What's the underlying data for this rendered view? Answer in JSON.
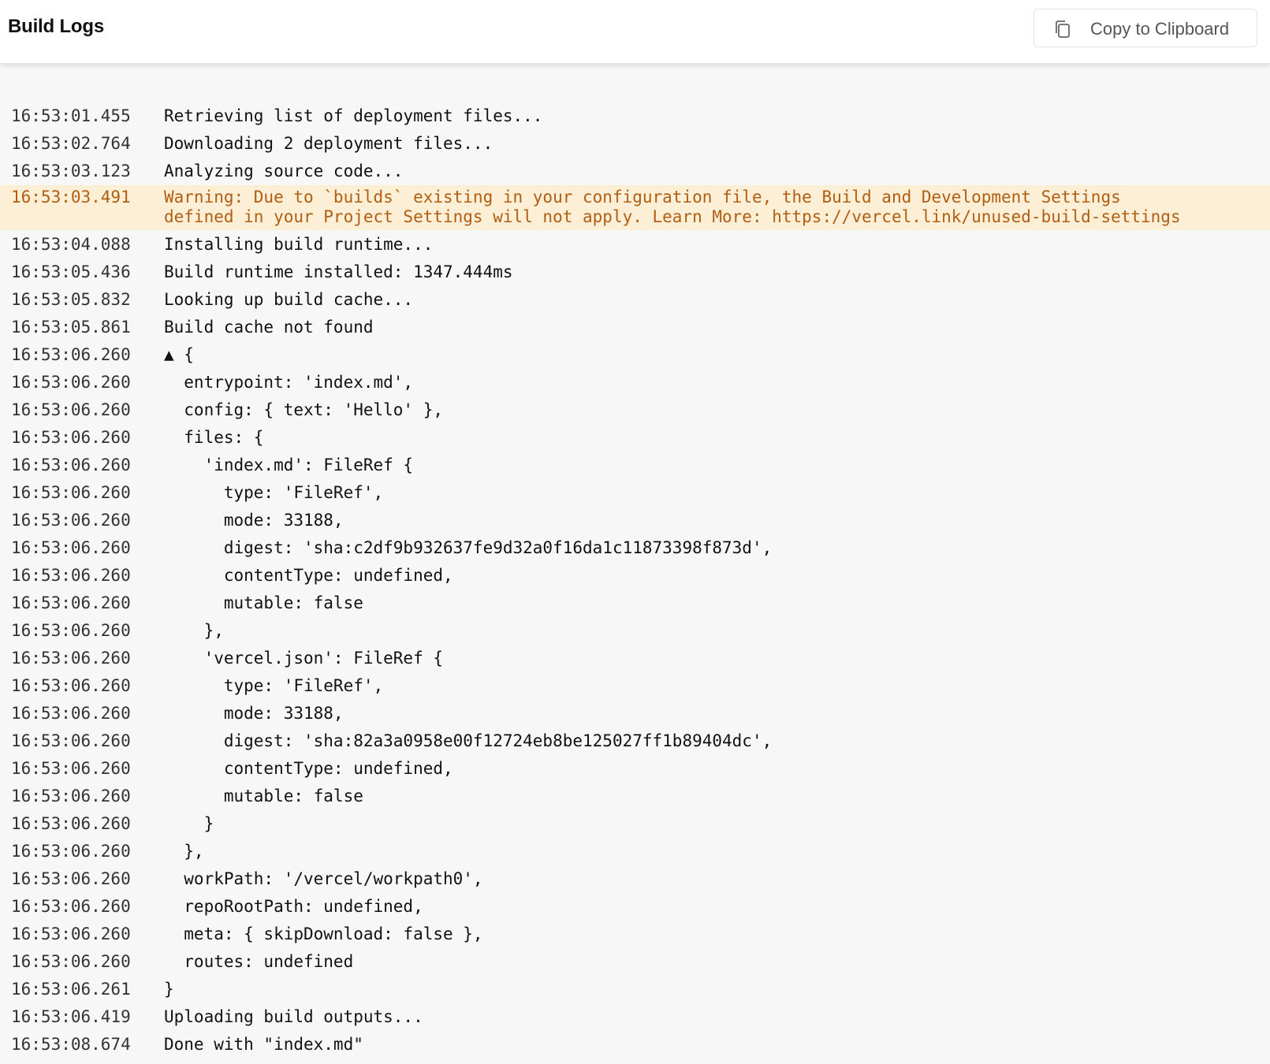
{
  "header": {
    "title": "Build Logs",
    "copy_button_label": "Copy to Clipboard",
    "copy_icon": "clipboard-copy-icon"
  },
  "colors": {
    "warning_background": "#fcefd5",
    "warning_text": "#b15d12"
  },
  "log": [
    {
      "time": "16:53:01.455",
      "text": "Retrieving list of deployment files..."
    },
    {
      "time": "16:53:02.764",
      "text": "Downloading 2 deployment files..."
    },
    {
      "time": "16:53:03.123",
      "text": "Analyzing source code..."
    },
    {
      "time": "16:53:03.491",
      "text": "Warning: Due to `builds` existing in your configuration file, the Build and Development Settings\ndefined in your Project Settings will not apply. Learn More: https://vercel.link/unused-build-settings",
      "level": "warning"
    },
    {
      "time": "16:53:04.088",
      "text": "Installing build runtime..."
    },
    {
      "time": "16:53:05.436",
      "text": "Build runtime installed: 1347.444ms"
    },
    {
      "time": "16:53:05.832",
      "text": "Looking up build cache..."
    },
    {
      "time": "16:53:05.861",
      "text": "Build cache not found"
    },
    {
      "time": "16:53:06.260",
      "text": "▲ {"
    },
    {
      "time": "16:53:06.260",
      "text": "  entrypoint: 'index.md',"
    },
    {
      "time": "16:53:06.260",
      "text": "  config: { text: 'Hello' },"
    },
    {
      "time": "16:53:06.260",
      "text": "  files: {"
    },
    {
      "time": "16:53:06.260",
      "text": "    'index.md': FileRef {"
    },
    {
      "time": "16:53:06.260",
      "text": "      type: 'FileRef',"
    },
    {
      "time": "16:53:06.260",
      "text": "      mode: 33188,"
    },
    {
      "time": "16:53:06.260",
      "text": "      digest: 'sha:c2df9b932637fe9d32a0f16da1c11873398f873d',"
    },
    {
      "time": "16:53:06.260",
      "text": "      contentType: undefined,"
    },
    {
      "time": "16:53:06.260",
      "text": "      mutable: false"
    },
    {
      "time": "16:53:06.260",
      "text": "    },"
    },
    {
      "time": "16:53:06.260",
      "text": "    'vercel.json': FileRef {"
    },
    {
      "time": "16:53:06.260",
      "text": "      type: 'FileRef',"
    },
    {
      "time": "16:53:06.260",
      "text": "      mode: 33188,"
    },
    {
      "time": "16:53:06.260",
      "text": "      digest: 'sha:82a3a0958e00f12724eb8be125027ff1b89404dc',"
    },
    {
      "time": "16:53:06.260",
      "text": "      contentType: undefined,"
    },
    {
      "time": "16:53:06.260",
      "text": "      mutable: false"
    },
    {
      "time": "16:53:06.260",
      "text": "    }"
    },
    {
      "time": "16:53:06.260",
      "text": "  },"
    },
    {
      "time": "16:53:06.260",
      "text": "  workPath: '/vercel/workpath0',"
    },
    {
      "time": "16:53:06.260",
      "text": "  repoRootPath: undefined,"
    },
    {
      "time": "16:53:06.260",
      "text": "  meta: { skipDownload: false },"
    },
    {
      "time": "16:53:06.260",
      "text": "  routes: undefined"
    },
    {
      "time": "16:53:06.261",
      "text": "}"
    },
    {
      "time": "16:53:06.419",
      "text": "Uploading build outputs..."
    },
    {
      "time": "16:53:08.674",
      "text": "Done with \"index.md\""
    }
  ]
}
